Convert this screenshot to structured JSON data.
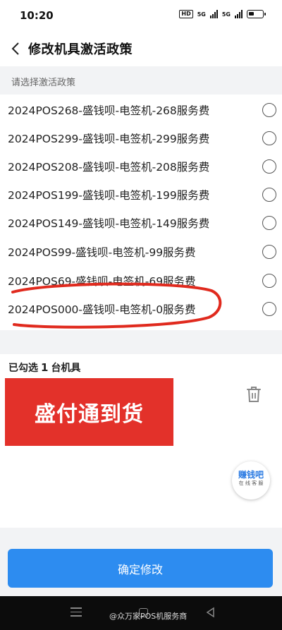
{
  "status_bar": {
    "time": "10:20",
    "hd": "HD",
    "net1": "5G",
    "net2": "5G"
  },
  "header": {
    "title": "修改机具激活政策"
  },
  "policy_section": {
    "hint": "请选择激活政策",
    "options": [
      {
        "label": "2024POS268-盛钱呗-电签机-268服务费",
        "selected": false
      },
      {
        "label": "2024POS299-盛钱呗-电签机-299服务费",
        "selected": false
      },
      {
        "label": "2024POS208-盛钱呗-电签机-208服务费",
        "selected": false
      },
      {
        "label": "2024POS199-盛钱呗-电签机-199服务费",
        "selected": false
      },
      {
        "label": "2024POS149-盛钱呗-电签机-149服务费",
        "selected": false
      },
      {
        "label": "2024POS99-盛钱呗-电签机-99服务费",
        "selected": false
      },
      {
        "label": "2024POS69-盛钱呗-电签机-69服务费",
        "selected": false
      },
      {
        "label": "2024POS000-盛钱呗-电签机-0服务费",
        "selected": false
      }
    ]
  },
  "selection": {
    "prefix": "已勾选",
    "count": "1",
    "suffix": "台机具"
  },
  "promo_banner": {
    "text": "盛付通到货"
  },
  "float_badge": {
    "main": "赚钱吧",
    "sub": "在 线 客 服"
  },
  "confirm_button": {
    "label": "确定修改"
  },
  "watermark": {
    "text": "@众万家POS机服务商"
  },
  "colors": {
    "primary": "#2d8cf0",
    "banner": "#e3312a",
    "annotation": "#e02a1e"
  }
}
